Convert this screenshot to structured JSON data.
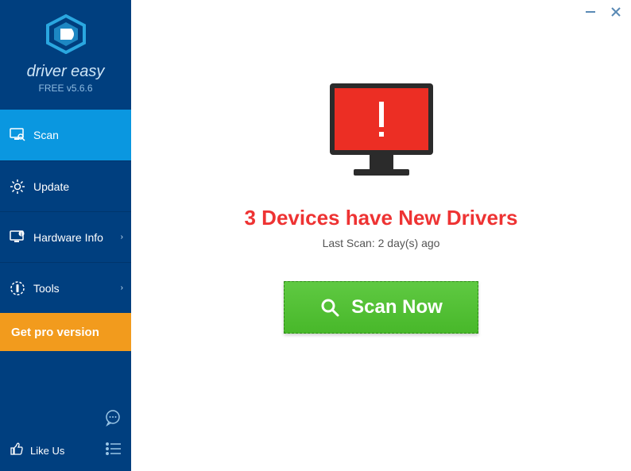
{
  "app": {
    "brand": "driver easy",
    "version_label": "FREE v5.6.6"
  },
  "sidebar": {
    "items": [
      {
        "label": "Scan",
        "has_chevron": false,
        "icon": "monitor-search-icon"
      },
      {
        "label": "Update",
        "has_chevron": false,
        "icon": "gear-icon"
      },
      {
        "label": "Hardware Info",
        "has_chevron": true,
        "icon": "monitor-info-icon"
      },
      {
        "label": "Tools",
        "has_chevron": true,
        "icon": "tools-icon"
      }
    ],
    "pro_button": "Get pro version",
    "like_us": "Like Us"
  },
  "main": {
    "headline": "3 Devices have New Drivers",
    "last_scan": "Last Scan: 2 day(s) ago",
    "scan_button": "Scan Now"
  },
  "colors": {
    "sidebar_bg": "#003f7f",
    "active_bg": "#0a97e0",
    "pro_bg": "#f29b1d",
    "alert_red": "#ec2e24",
    "headline_red": "#e33",
    "scan_green": "#48b82a"
  }
}
